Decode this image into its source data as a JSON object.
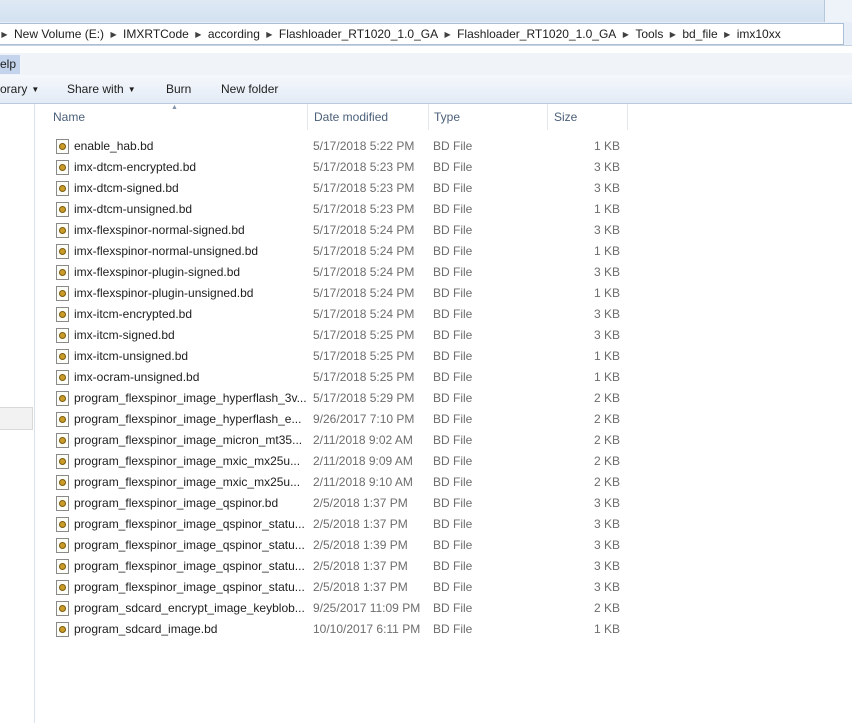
{
  "breadcrumb": [
    "New Volume (E:)",
    "IMXRTCode",
    "according",
    "Flashloader_RT1020_1.0_GA",
    "Flashloader_RT1020_1.0_GA",
    "Tools",
    "bd_file",
    "imx10xx"
  ],
  "breadcrumb_separator": "▶",
  "menu": {
    "help": "elp"
  },
  "toolbar": {
    "library": "orary",
    "share_with": "Share with",
    "burn": "Burn",
    "new_folder": "New folder",
    "dropdown_glyph": "▼"
  },
  "columns": {
    "name": "Name",
    "date_modified": "Date modified",
    "type": "Type",
    "size": "Size",
    "sort_glyph": "▲"
  },
  "files": [
    {
      "name": "enable_hab.bd",
      "date": "5/17/2018 5:22 PM",
      "type": "BD File",
      "size": "1 KB"
    },
    {
      "name": "imx-dtcm-encrypted.bd",
      "date": "5/17/2018 5:23 PM",
      "type": "BD File",
      "size": "3 KB"
    },
    {
      "name": "imx-dtcm-signed.bd",
      "date": "5/17/2018 5:23 PM",
      "type": "BD File",
      "size": "3 KB"
    },
    {
      "name": "imx-dtcm-unsigned.bd",
      "date": "5/17/2018 5:23 PM",
      "type": "BD File",
      "size": "1 KB"
    },
    {
      "name": "imx-flexspinor-normal-signed.bd",
      "date": "5/17/2018 5:24 PM",
      "type": "BD File",
      "size": "3 KB"
    },
    {
      "name": "imx-flexspinor-normal-unsigned.bd",
      "date": "5/17/2018 5:24 PM",
      "type": "BD File",
      "size": "1 KB"
    },
    {
      "name": "imx-flexspinor-plugin-signed.bd",
      "date": "5/17/2018 5:24 PM",
      "type": "BD File",
      "size": "3 KB"
    },
    {
      "name": "imx-flexspinor-plugin-unsigned.bd",
      "date": "5/17/2018 5:24 PM",
      "type": "BD File",
      "size": "1 KB"
    },
    {
      "name": "imx-itcm-encrypted.bd",
      "date": "5/17/2018 5:24 PM",
      "type": "BD File",
      "size": "3 KB"
    },
    {
      "name": "imx-itcm-signed.bd",
      "date": "5/17/2018 5:25 PM",
      "type": "BD File",
      "size": "3 KB"
    },
    {
      "name": "imx-itcm-unsigned.bd",
      "date": "5/17/2018 5:25 PM",
      "type": "BD File",
      "size": "1 KB"
    },
    {
      "name": "imx-ocram-unsigned.bd",
      "date": "5/17/2018 5:25 PM",
      "type": "BD File",
      "size": "1 KB"
    },
    {
      "name": "program_flexspinor_image_hyperflash_3v...",
      "date": "5/17/2018 5:29 PM",
      "type": "BD File",
      "size": "2 KB"
    },
    {
      "name": "program_flexspinor_image_hyperflash_e...",
      "date": "9/26/2017 7:10 PM",
      "type": "BD File",
      "size": "2 KB"
    },
    {
      "name": "program_flexspinor_image_micron_mt35...",
      "date": "2/11/2018 9:02 AM",
      "type": "BD File",
      "size": "2 KB"
    },
    {
      "name": "program_flexspinor_image_mxic_mx25u...",
      "date": "2/11/2018 9:09 AM",
      "type": "BD File",
      "size": "2 KB"
    },
    {
      "name": "program_flexspinor_image_mxic_mx25u...",
      "date": "2/11/2018 9:10 AM",
      "type": "BD File",
      "size": "2 KB"
    },
    {
      "name": "program_flexspinor_image_qspinor.bd",
      "date": "2/5/2018 1:37 PM",
      "type": "BD File",
      "size": "3 KB"
    },
    {
      "name": "program_flexspinor_image_qspinor_statu...",
      "date": "2/5/2018 1:37 PM",
      "type": "BD File",
      "size": "3 KB"
    },
    {
      "name": "program_flexspinor_image_qspinor_statu...",
      "date": "2/5/2018 1:39 PM",
      "type": "BD File",
      "size": "3 KB"
    },
    {
      "name": "program_flexspinor_image_qspinor_statu...",
      "date": "2/5/2018 1:37 PM",
      "type": "BD File",
      "size": "3 KB"
    },
    {
      "name": "program_flexspinor_image_qspinor_statu...",
      "date": "2/5/2018 1:37 PM",
      "type": "BD File",
      "size": "3 KB"
    },
    {
      "name": "program_sdcard_encrypt_image_keyblob...",
      "date": "9/25/2017 11:09 PM",
      "type": "BD File",
      "size": "2 KB"
    },
    {
      "name": "program_sdcard_image.bd",
      "date": "10/10/2017 6:11 PM",
      "type": "BD File",
      "size": "1 KB"
    }
  ]
}
